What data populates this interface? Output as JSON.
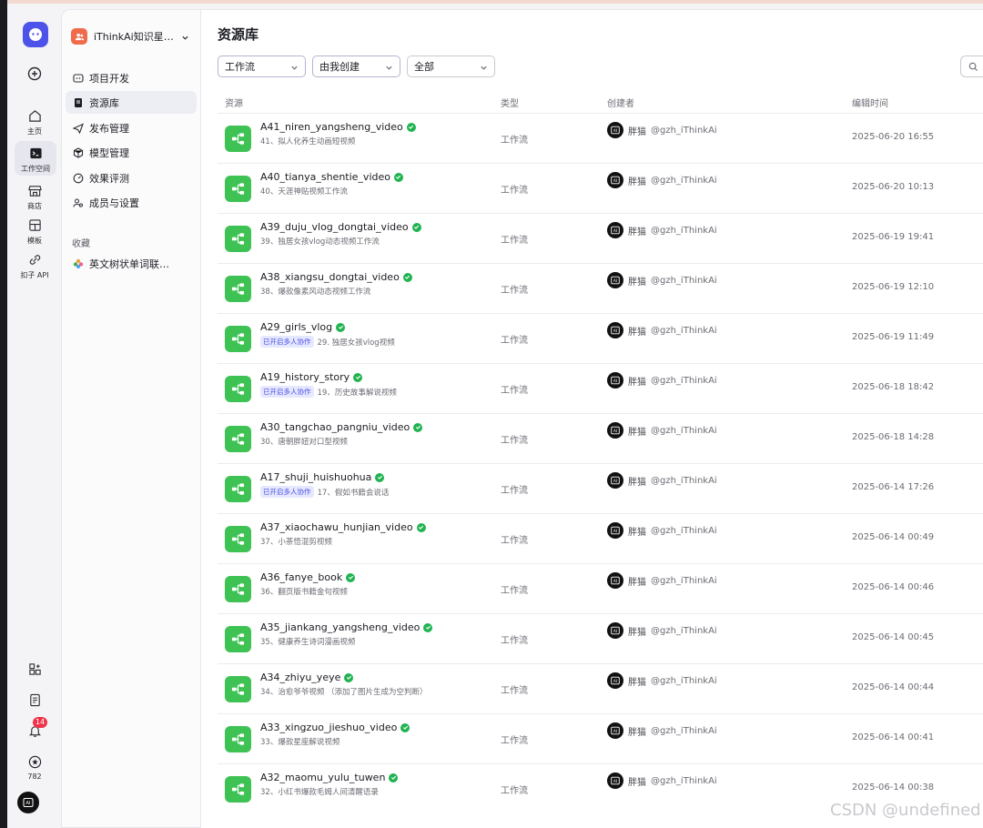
{
  "sidebar_rail": {
    "items": [
      {
        "label": "主页",
        "icon": "home-icon"
      },
      {
        "label": "工作空间",
        "icon": "terminal-icon"
      },
      {
        "label": "商店",
        "icon": "store-icon"
      },
      {
        "label": "模板",
        "icon": "template-icon"
      },
      {
        "label": "扣子 API",
        "icon": "api-icon"
      }
    ],
    "notification_count": "14",
    "points": "782"
  },
  "workspace": {
    "name": "iThinkAi知识星…"
  },
  "nav": {
    "items": [
      {
        "label": "项目开发",
        "icon": "project-icon"
      },
      {
        "label": "资源库",
        "icon": "library-icon"
      },
      {
        "label": "发布管理",
        "icon": "publish-icon"
      },
      {
        "label": "模型管理",
        "icon": "model-icon"
      },
      {
        "label": "效果评测",
        "icon": "evaluation-icon"
      },
      {
        "label": "成员与设置",
        "icon": "members-icon"
      }
    ],
    "favorites_title": "收藏",
    "favorites": [
      {
        "label": "英文树状单词联…"
      }
    ]
  },
  "main": {
    "title": "资源库",
    "filters": {
      "type": "工作流",
      "creator": "由我创建",
      "status": "全部"
    },
    "columns": {
      "resource": "资源",
      "type": "类型",
      "creator": "创建者",
      "edited": "编辑时间"
    },
    "rows": [
      {
        "name": "A41_niren_yangsheng_video",
        "tag": "",
        "desc": "41、拟人化养生动画短视频",
        "type": "工作流",
        "creator": "胖猫",
        "handle": "@gzh_iThinkAi",
        "time": "2025-06-20 16:55"
      },
      {
        "name": "A40_tianya_shentie_video",
        "tag": "",
        "desc": "40、天涯神贴视频工作流",
        "type": "工作流",
        "creator": "胖猫",
        "handle": "@gzh_iThinkAi",
        "time": "2025-06-20 10:13"
      },
      {
        "name": "A39_duju_vlog_dongtai_video",
        "tag": "",
        "desc": "39、独居女孩vlog动态视频工作流",
        "type": "工作流",
        "creator": "胖猫",
        "handle": "@gzh_iThinkAi",
        "time": "2025-06-19 19:41"
      },
      {
        "name": "A38_xiangsu_dongtai_video",
        "tag": "",
        "desc": "38、爆款像素风动态视频工作流",
        "type": "工作流",
        "creator": "胖猫",
        "handle": "@gzh_iThinkAi",
        "time": "2025-06-19 12:10"
      },
      {
        "name": "A29_girls_vlog",
        "tag": "已开启多人协作",
        "desc": "29. 独居女孩vlog视频",
        "type": "工作流",
        "creator": "胖猫",
        "handle": "@gzh_iThinkAi",
        "time": "2025-06-19 11:49"
      },
      {
        "name": "A19_history_story",
        "tag": "已开启多人协作",
        "desc": "19、历史故事解说视频",
        "type": "工作流",
        "creator": "胖猫",
        "handle": "@gzh_iThinkAi",
        "time": "2025-06-18 18:42"
      },
      {
        "name": "A30_tangchao_pangniu_video",
        "tag": "",
        "desc": "30、唐朝胖妞对口型视频",
        "type": "工作流",
        "creator": "胖猫",
        "handle": "@gzh_iThinkAi",
        "time": "2025-06-18 14:28"
      },
      {
        "name": "A17_shuji_huishuohua",
        "tag": "已开启多人协作",
        "desc": "17、假如书籍会说话",
        "type": "工作流",
        "creator": "胖猫",
        "handle": "@gzh_iThinkAi",
        "time": "2025-06-14 17:26"
      },
      {
        "name": "A37_xiaochawu_hunjian_video",
        "tag": "",
        "desc": "37、小茶悟混剪视频",
        "type": "工作流",
        "creator": "胖猫",
        "handle": "@gzh_iThinkAi",
        "time": "2025-06-14 00:49"
      },
      {
        "name": "A36_fanye_book",
        "tag": "",
        "desc": "36、翻页版书籍金句视频",
        "type": "工作流",
        "creator": "胖猫",
        "handle": "@gzh_iThinkAi",
        "time": "2025-06-14 00:46"
      },
      {
        "name": "A35_jiankang_yangsheng_video",
        "tag": "",
        "desc": "35、健康养生诗词漫画视频",
        "type": "工作流",
        "creator": "胖猫",
        "handle": "@gzh_iThinkAi",
        "time": "2025-06-14 00:45"
      },
      {
        "name": "A34_zhiyu_yeye",
        "tag": "",
        "desc": "34、治愈爷爷视频 （添加了图片生成为空判断）",
        "type": "工作流",
        "creator": "胖猫",
        "handle": "@gzh_iThinkAi",
        "time": "2025-06-14 00:44"
      },
      {
        "name": "A33_xingzuo_jieshuo_video",
        "tag": "",
        "desc": "33、爆款星座解说视频",
        "type": "工作流",
        "creator": "胖猫",
        "handle": "@gzh_iThinkAi",
        "time": "2025-06-14 00:41"
      },
      {
        "name": "A32_maomu_yulu_tuwen",
        "tag": "",
        "desc": "32、小红书爆款毛姆人间清醒语录",
        "type": "工作流",
        "creator": "胖猫",
        "handle": "@gzh_iThinkAi",
        "time": "2025-06-14 00:38"
      }
    ]
  },
  "watermark": "CSDN @undefined",
  "colors": {
    "accent": "#4d53e8",
    "workflow_icon_bg": "#3ec254",
    "verified": "#21b351",
    "badge": "#f0334a"
  }
}
